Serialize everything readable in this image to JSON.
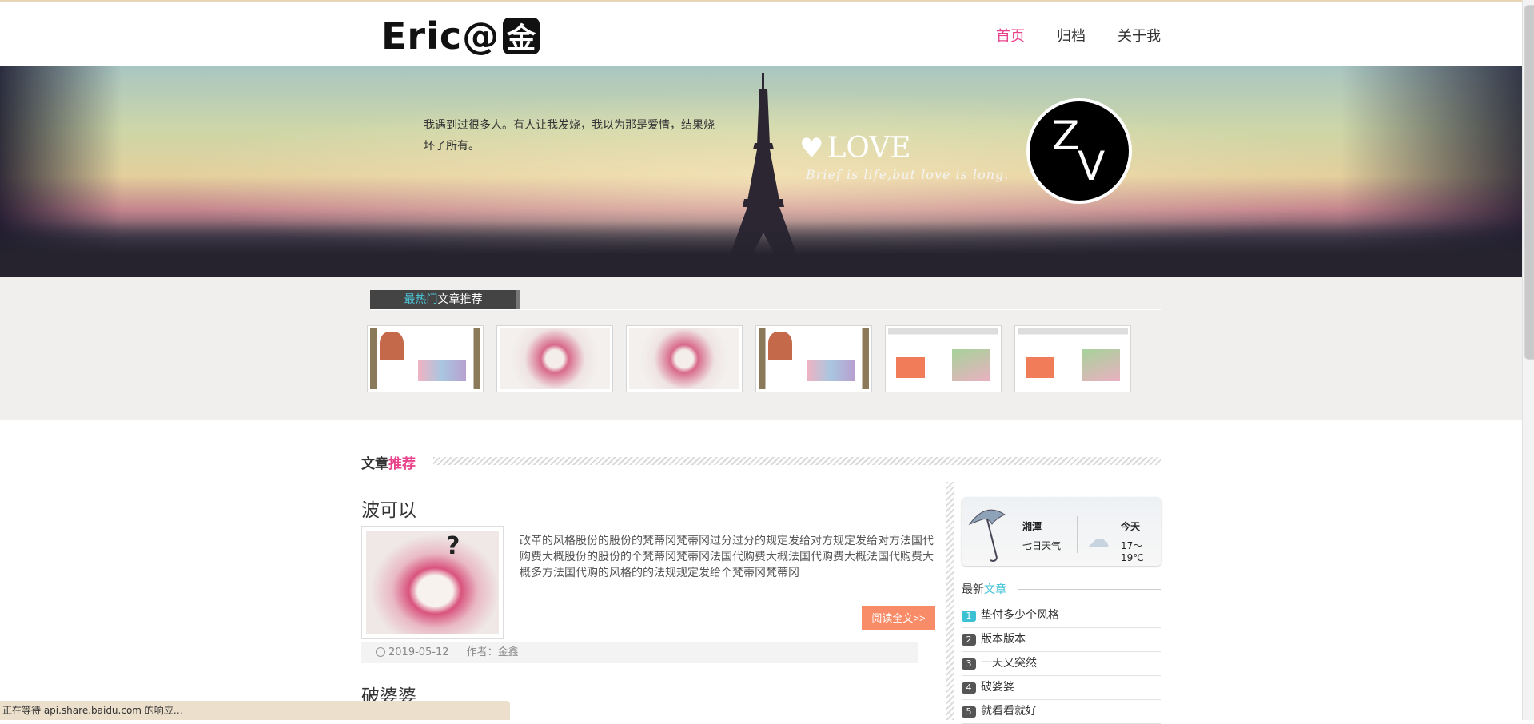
{
  "header": {
    "logo_text": "Eric@",
    "logo_mark": "金",
    "nav": [
      {
        "label": "首页"
      },
      {
        "label": "归档"
      },
      {
        "label": "关于我"
      }
    ]
  },
  "banner": {
    "quote": "我遇到过很多人。有人让我发烧，我以为那是爱情，结果烧坏了所有。",
    "love_heading": "LOVE",
    "love_sub": "Brief is life,but love is long.",
    "avatar_z": "Z",
    "avatar_v": "V"
  },
  "hot": {
    "title_accent": "最热门",
    "title_rest": "文章推荐",
    "thumb_styles": [
      "site",
      "heart",
      "heart",
      "site",
      "page",
      "page"
    ]
  },
  "articles": {
    "section_title": "文章",
    "section_accent": "推荐",
    "posts": [
      {
        "title": "波可以",
        "excerpt": "改革的风格股份的股份的梵蒂冈梵蒂冈过分过分的规定发给对方规定发给对方法国代购费大概股份的股份的个梵蒂冈梵蒂冈法国代购费大概法国代购费大概法国代购费大概多方法国代购的风格的的法规规定发给个梵蒂冈梵蒂冈",
        "read_more": "阅读全文>>",
        "date": "2019-05-12",
        "author_label": "作者：金鑫"
      },
      {
        "title": "破婆婆"
      }
    ]
  },
  "sidebar": {
    "weather": {
      "city": "湘潭",
      "days": "七日天气",
      "today": "今天",
      "temp": "17～19℃"
    },
    "latest_title": "最新",
    "latest_accent": "文章",
    "latest": [
      {
        "num": "1",
        "label": "垫付多少个风格"
      },
      {
        "num": "2",
        "label": "版本版本"
      },
      {
        "num": "3",
        "label": "一天又突然"
      },
      {
        "num": "4",
        "label": "破婆婆"
      },
      {
        "num": "5",
        "label": "就看看就好"
      }
    ]
  },
  "status_bar": "正在等待 api.share.baidu.com 的响应…"
}
